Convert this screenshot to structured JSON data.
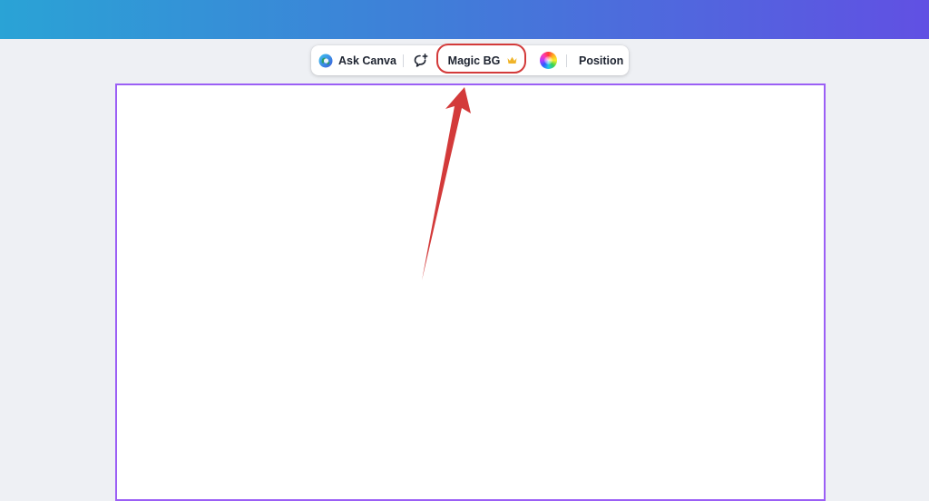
{
  "toolbar": {
    "ask_label": "Ask Canva",
    "ask_icon": "ask-canva-globe-icon",
    "comment_icon": "comment-add-icon",
    "magic_bg_label": "Magic BG",
    "magic_bg_badge_icon": "crown-icon",
    "color_icon": "color-wheel-icon",
    "position_label": "Position"
  },
  "annotation": {
    "highlight_color": "#d33a3a",
    "target": "Magic BG"
  },
  "colors": {
    "header_gradient_start": "#2aa3d6",
    "header_gradient_end": "#6150e3",
    "page_border": "#9b5ff5",
    "workspace_background": "#eef0f4",
    "crown": "#f0b429"
  }
}
